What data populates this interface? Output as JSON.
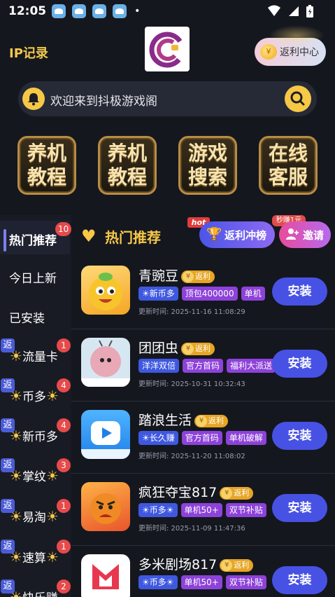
{
  "status_bar": {
    "time": "12:05",
    "app_icons": [
      "app-icon",
      "app-icon",
      "app-icon",
      "app-icon"
    ],
    "dot": "•"
  },
  "header": {
    "ip_record": "IP记录",
    "rebate_center": "返利中心",
    "logo": "brand-logo"
  },
  "search": {
    "welcome_text": "欢迎来到抖极游戏阁"
  },
  "quick_buttons": [
    {
      "label": "养机教程"
    },
    {
      "label": "养机教程"
    },
    {
      "label": "游戏搜索"
    },
    {
      "label": "在线客服"
    }
  ],
  "sidebar": {
    "active": {
      "label": "热门推荐",
      "badge": "10"
    },
    "items": [
      {
        "label": "今日上新"
      },
      {
        "label": "已安装"
      }
    ],
    "rebate_items": [
      {
        "tag": "返",
        "label": "流量卡",
        "badge": "1"
      },
      {
        "tag": "返",
        "label": "币多",
        "badge": "4"
      },
      {
        "tag": "返",
        "label": "新币多",
        "badge": "4"
      },
      {
        "tag": "返",
        "label": "掌纹",
        "badge": "3"
      },
      {
        "tag": "返",
        "label": "易淘",
        "badge": "1"
      },
      {
        "tag": "返",
        "label": "速算",
        "badge": "1"
      },
      {
        "tag": "返",
        "label": "快乐赚",
        "badge": "2"
      }
    ]
  },
  "main": {
    "title": "热门推荐",
    "hot_tag": "hot",
    "rank_button": "返利冲榜",
    "earn_tag": "秒赚1元",
    "invite_button": "邀请",
    "install_label": "安装",
    "update_prefix": "更新时间:",
    "games": [
      {
        "name": "青豌豆",
        "badge": "返利",
        "tags": [
          "☀新币多",
          "顶包400000",
          "单机"
        ],
        "updated": "更新时间: 2025-11-16 11:08:29"
      },
      {
        "name": "团团虫",
        "badge": "返利",
        "tags": [
          "洋洋双倍",
          "官方首码",
          "福利大派送"
        ],
        "updated": "更新时间: 2025-10-31 10:32:43"
      },
      {
        "name": "踏浪生活",
        "badge": "返利",
        "tags": [
          "☀长久赚",
          "官方首码",
          "单机破解"
        ],
        "updated": "更新时间: 2025-11-20 11:08:02"
      },
      {
        "name": "疯狂夺宝817",
        "badge": "返利",
        "tags": [
          "☀币多☀",
          "单机50+",
          "双节补贴"
        ],
        "updated": "更新时间: 2025-11-09 11:47:36"
      },
      {
        "name": "多米剧场817",
        "badge": "返利",
        "tags": [
          "☀币多☀",
          "单机50+",
          "双节补贴"
        ],
        "updated": ""
      }
    ]
  },
  "colors": {
    "accent_gold": "#f6c846",
    "install_blue": "#4752e4",
    "background": "#15171f"
  }
}
